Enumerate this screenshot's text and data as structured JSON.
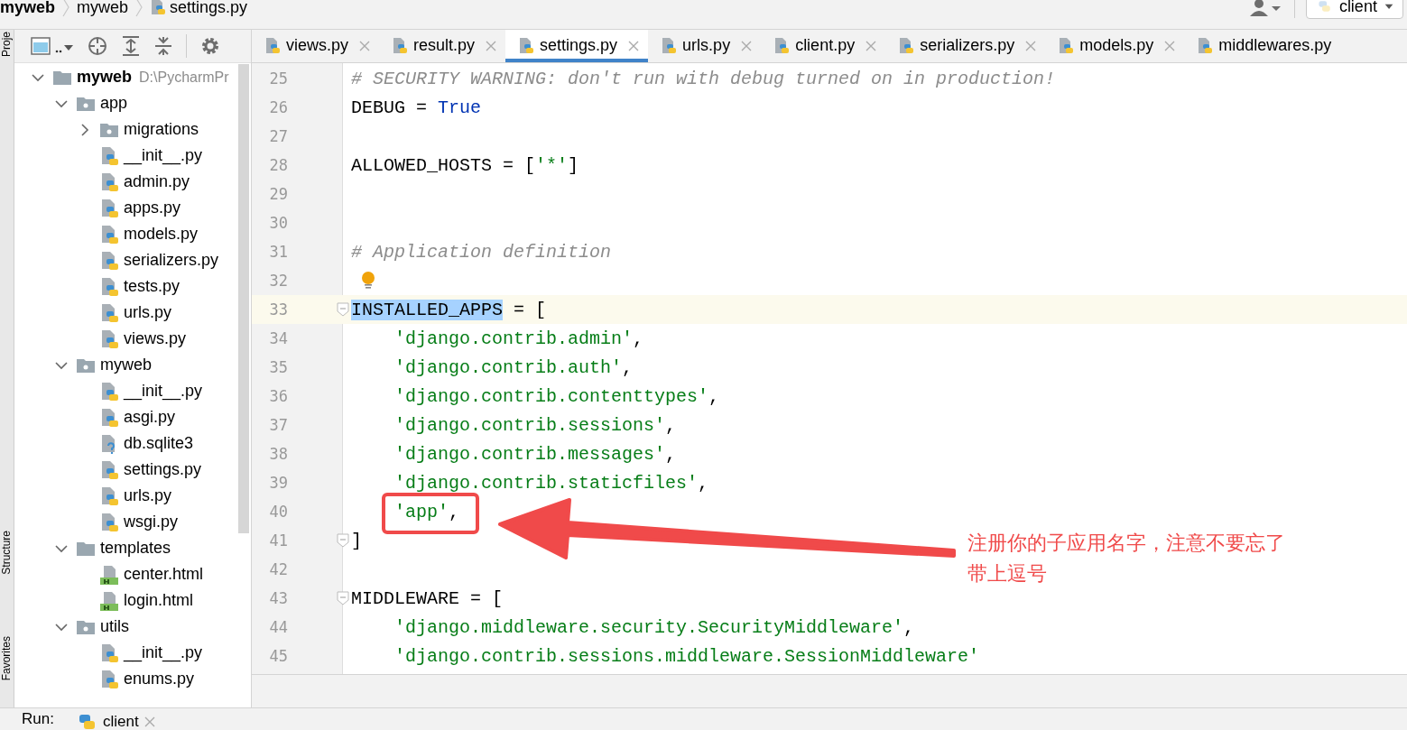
{
  "breadcrumb": [
    {
      "label": "myweb",
      "bold": true,
      "file": false
    },
    {
      "label": "myweb",
      "bold": false,
      "file": false
    },
    {
      "label": "settings.py",
      "bold": false,
      "file": true
    }
  ],
  "run_config": {
    "label": "client"
  },
  "side_strip": [
    "Proje",
    "Structure",
    "Favorites"
  ],
  "tabs": [
    {
      "label": "views.py",
      "selected": false,
      "closable": true
    },
    {
      "label": "result.py",
      "selected": false,
      "closable": true
    },
    {
      "label": "settings.py",
      "selected": true,
      "closable": true
    },
    {
      "label": "urls.py",
      "selected": false,
      "closable": true
    },
    {
      "label": "client.py",
      "selected": false,
      "closable": true
    },
    {
      "label": "serializers.py",
      "selected": false,
      "closable": true
    },
    {
      "label": "models.py",
      "selected": false,
      "closable": true
    },
    {
      "label": "middlewares.py",
      "selected": false,
      "closable": false
    }
  ],
  "project_tree": [
    {
      "label": "myweb",
      "kind": "folder",
      "path": "D:\\PycharmPr",
      "expanded": true,
      "children": [
        {
          "label": "app",
          "kind": "package",
          "expanded": true,
          "children": [
            {
              "label": "migrations",
              "kind": "package",
              "expanded": false
            },
            {
              "label": "__init__.py",
              "kind": "py"
            },
            {
              "label": "admin.py",
              "kind": "py"
            },
            {
              "label": "apps.py",
              "kind": "py"
            },
            {
              "label": "models.py",
              "kind": "py"
            },
            {
              "label": "serializers.py",
              "kind": "py"
            },
            {
              "label": "tests.py",
              "kind": "py"
            },
            {
              "label": "urls.py",
              "kind": "py"
            },
            {
              "label": "views.py",
              "kind": "py"
            }
          ]
        },
        {
          "label": "myweb",
          "kind": "package",
          "expanded": true,
          "children": [
            {
              "label": "__init__.py",
              "kind": "py"
            },
            {
              "label": "asgi.py",
              "kind": "py"
            },
            {
              "label": "db.sqlite3",
              "kind": "unknown"
            },
            {
              "label": "settings.py",
              "kind": "py"
            },
            {
              "label": "urls.py",
              "kind": "py"
            },
            {
              "label": "wsgi.py",
              "kind": "py"
            }
          ]
        },
        {
          "label": "templates",
          "kind": "folder",
          "expanded": true,
          "children": [
            {
              "label": "center.html",
              "kind": "html"
            },
            {
              "label": "login.html",
              "kind": "html"
            }
          ]
        },
        {
          "label": "utils",
          "kind": "package",
          "expanded": true,
          "children": [
            {
              "label": "__init__.py",
              "kind": "py"
            },
            {
              "label": "enums.py",
              "kind": "py"
            }
          ]
        }
      ]
    }
  ],
  "code_lines": [
    {
      "number": "25",
      "tokens": [
        {
          "kind": "comment",
          "text": "# SECURITY WARNING: don't run with debug turned on in production!"
        }
      ]
    },
    {
      "number": "26",
      "tokens": [
        {
          "kind": "plain",
          "text": "DEBUG = "
        },
        {
          "kind": "keyword",
          "text": "True"
        }
      ]
    },
    {
      "number": "27"
    },
    {
      "number": "28",
      "tokens": [
        {
          "kind": "plain",
          "text": "ALLOWED_HOSTS = ["
        },
        {
          "kind": "string",
          "text": "'*'"
        },
        {
          "kind": "plain",
          "text": "]"
        }
      ]
    },
    {
      "number": "29"
    },
    {
      "number": "30"
    },
    {
      "number": "31",
      "tokens": [
        {
          "kind": "comment",
          "text": "# Application definition"
        }
      ]
    },
    {
      "number": "32",
      "bulb": true
    },
    {
      "number": "33",
      "current": true,
      "fold": true,
      "tokens": [
        {
          "kind": "selection",
          "text": "INSTALLED_APPS"
        },
        {
          "kind": "plain",
          "text": " = ["
        }
      ]
    },
    {
      "number": "34",
      "indent": true,
      "tokens": [
        {
          "kind": "string",
          "text": "'django.contrib.admin'"
        },
        {
          "kind": "plain",
          "text": ","
        }
      ]
    },
    {
      "number": "35",
      "indent": true,
      "tokens": [
        {
          "kind": "string",
          "text": "'django.contrib.auth'"
        },
        {
          "kind": "plain",
          "text": ","
        }
      ]
    },
    {
      "number": "36",
      "indent": true,
      "tokens": [
        {
          "kind": "string",
          "text": "'django.contrib.contenttypes'"
        },
        {
          "kind": "plain",
          "text": ","
        }
      ]
    },
    {
      "number": "37",
      "indent": true,
      "tokens": [
        {
          "kind": "string",
          "text": "'django.contrib.sessions'"
        },
        {
          "kind": "plain",
          "text": ","
        }
      ]
    },
    {
      "number": "38",
      "indent": true,
      "tokens": [
        {
          "kind": "string",
          "text": "'django.contrib.messages'"
        },
        {
          "kind": "plain",
          "text": ","
        }
      ]
    },
    {
      "number": "39",
      "indent": true,
      "tokens": [
        {
          "kind": "string",
          "text": "'django.contrib.staticfiles'"
        },
        {
          "kind": "plain",
          "text": ","
        }
      ]
    },
    {
      "number": "40",
      "indent": true,
      "tokens": [
        {
          "kind": "string",
          "text": "'app'"
        },
        {
          "kind": "plain",
          "text": ","
        }
      ]
    },
    {
      "number": "41",
      "fold": true,
      "tokens": [
        {
          "kind": "plain",
          "text": "]"
        }
      ]
    },
    {
      "number": "42"
    },
    {
      "number": "43",
      "fold": true,
      "tokens": [
        {
          "kind": "plain",
          "text": "MIDDLEWARE = ["
        }
      ]
    },
    {
      "number": "44",
      "indent": true,
      "tokens": [
        {
          "kind": "string",
          "text": "'django.middleware.security.SecurityMiddleware'"
        },
        {
          "kind": "plain",
          "text": ","
        }
      ]
    },
    {
      "number": "45",
      "indent": true,
      "tokens": [
        {
          "kind": "string",
          "text": "'django.contrib.sessions.middleware.SessionMiddleware'"
        }
      ]
    }
  ],
  "annotation": {
    "lines": [
      "注册你的子应用名字，注意不要忘了",
      "带上逗号"
    ]
  },
  "run_bar": {
    "label": "Run:",
    "tab": "client"
  }
}
